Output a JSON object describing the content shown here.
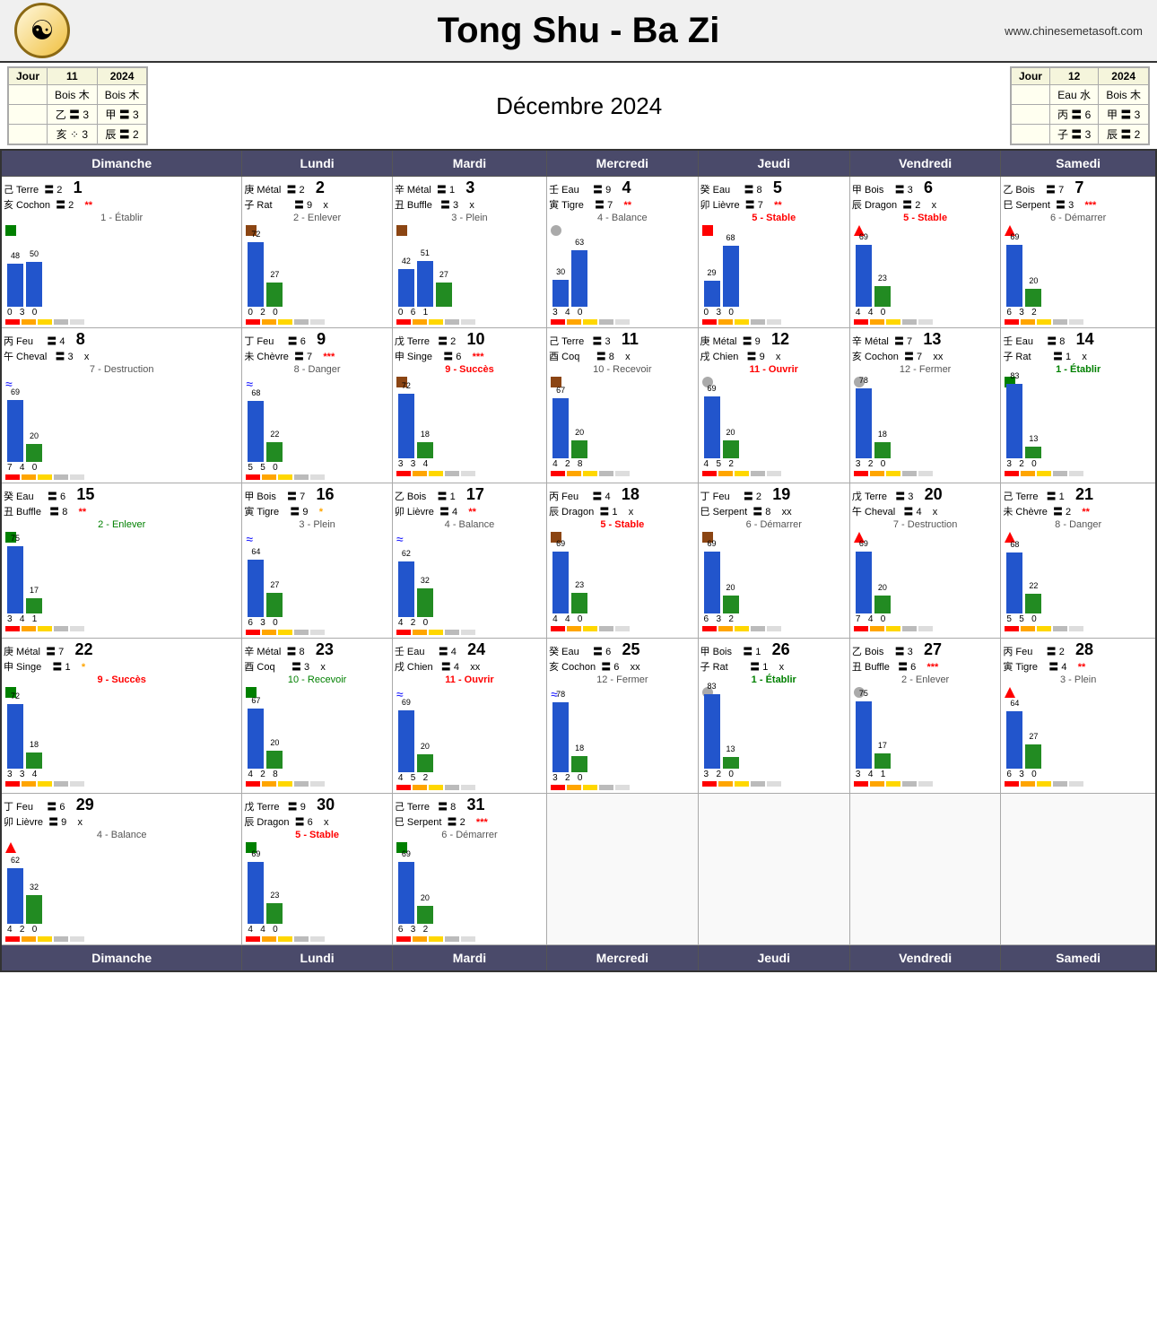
{
  "title": "Tong Shu - Ba Zi",
  "website": "www.chinesemetasoft.com",
  "month": "Décembre 2024",
  "day11": {
    "jour": "Jour",
    "num": "11",
    "year": "2024",
    "row1": "Bois 木",
    "row1b": "Bois 木",
    "row2": "乙 〓 3",
    "row2b": "甲 〓 3",
    "row3": "亥 ⁘ 3",
    "row3b": "辰 〓 2"
  },
  "day12": {
    "jour": "Jour",
    "num": "12",
    "year": "2024",
    "row1": "Eau 水",
    "row1b": "Bois 木",
    "row2": "丙 〓 6",
    "row2b": "甲 〓 3",
    "row3": "子 〓 3",
    "row3b": "辰 〓 2"
  },
  "weekdays": [
    "Dimanche",
    "Lundi",
    "Mardi",
    "Mercredi",
    "Jeudi",
    "Vendredi",
    "Samedi"
  ],
  "cells": [
    {
      "day": 1,
      "col": 0,
      "stem": "己 Terre",
      "hex1": "〓 2",
      "num": "1",
      "branch": "亥 Cochon",
      "hex2": "〓 2",
      "star": "**",
      "label": "1 - Établir",
      "label_color": "normal",
      "indicator": "green",
      "bars": [
        {
          "val": 48,
          "color": "blue"
        },
        {
          "val": 50,
          "color": "blue"
        },
        {
          "val": 0,
          "color": "none"
        },
        {
          "val": 0,
          "color": "none"
        },
        {
          "val": 0,
          "color": "none"
        },
        {
          "val": 0,
          "color": "none"
        }
      ],
      "bar_vals": [
        48,
        50
      ],
      "bar2_vals": [],
      "nums": "0  3  0",
      "strips": [
        "red",
        "orange",
        "yellow",
        "gray",
        "white"
      ]
    },
    {
      "day": 2,
      "col": 1,
      "stem": "庚 Métal",
      "hex1": "〓 2",
      "num": "2",
      "branch": "子 Rat",
      "hex2": "〓 9",
      "star": "x",
      "label": "2 - Enlever",
      "label_color": "normal",
      "indicator": "brown",
      "bars_b1": 72,
      "bars_b2": 27,
      "nums": "0  2  0",
      "strips": [
        "red",
        "orange",
        "yellow",
        "gray",
        "white"
      ]
    },
    {
      "day": 3,
      "col": 2,
      "stem": "辛 Métal",
      "hex1": "〓 1",
      "num": "3",
      "branch": "丑 Buffle",
      "hex2": "〓 3",
      "star": "x",
      "label": "3 - Plein",
      "label_color": "normal",
      "indicator": "brown",
      "bars_b1": 42,
      "bars_b2": 51,
      "bars_g": 27,
      "nums": "0  6  1",
      "strips": [
        "red",
        "orange",
        "yellow",
        "gray",
        "white"
      ]
    },
    {
      "day": 4,
      "col": 3,
      "stem": "壬 Eau",
      "hex1": "〓 9",
      "num": "4",
      "branch": "寅 Tigre",
      "hex2": "〓 7",
      "star": "**",
      "label": "4 - Balance",
      "label_color": "normal",
      "indicator": "gray",
      "bars_b1": 30,
      "bars_b2": 63,
      "nums": "3  4  0",
      "strips": [
        "red",
        "orange",
        "yellow",
        "gray",
        "white"
      ]
    },
    {
      "day": 5,
      "col": 4,
      "stem": "癸 Eau",
      "hex1": "〓 8",
      "num": "5",
      "branch": "卯 Lièvre",
      "hex2": "〓 7",
      "star": "**",
      "label": "5 - Stable",
      "label_color": "red",
      "indicator": "red",
      "bars_b1": 29,
      "bars_b2": 68,
      "nums": "0  3  0",
      "strips": [
        "red",
        "orange",
        "yellow",
        "gray",
        "white"
      ]
    },
    {
      "day": 6,
      "col": 5,
      "stem": "甲 Bois",
      "hex1": "〓 3",
      "num": "6",
      "branch": "辰 Dragon",
      "hex2": "〓 2",
      "star": "x",
      "label": "5 - Stable",
      "label_color": "red",
      "indicator": "red",
      "bars_b1": 69,
      "bars_g": 23,
      "nums": "4  4  0",
      "strips": [
        "red",
        "orange",
        "yellow",
        "gray",
        "white"
      ]
    },
    {
      "day": 7,
      "col": 6,
      "stem": "乙 Bois",
      "hex1": "〓 7",
      "num": "7",
      "branch": "巳 Serpent",
      "hex2": "〓 3",
      "star": "***",
      "label": "6 - Démarrer",
      "label_color": "normal",
      "indicator": "red",
      "bars_b1": 69,
      "bars_g": 20,
      "nums": "6  3  2",
      "strips": [
        "red",
        "orange",
        "yellow",
        "gray",
        "white"
      ]
    }
  ]
}
